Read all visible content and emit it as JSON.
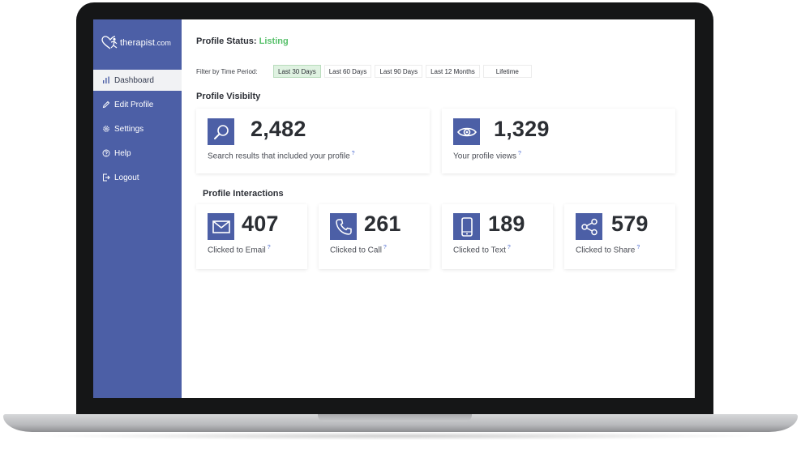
{
  "brand": {
    "name": "therapist",
    "tld": ".com"
  },
  "sidebar": {
    "items": [
      {
        "label": "Dashboard",
        "icon": "bar-chart-icon",
        "active": true
      },
      {
        "label": "Edit Profile",
        "icon": "pencil-icon",
        "active": false
      },
      {
        "label": "Settings",
        "icon": "gear-icon",
        "active": false
      },
      {
        "label": "Help",
        "icon": "question-icon",
        "active": false
      },
      {
        "label": "Logout",
        "icon": "logout-icon",
        "active": false
      }
    ]
  },
  "status": {
    "label": "Profile Status:",
    "value": "Listing",
    "value_color": "#57c06a"
  },
  "filter": {
    "label": "Filter by Time Period:",
    "options": [
      "Last 30 Days",
      "Last 60 Days",
      "Last 90 Days",
      "Last 12 Months",
      "Lifetime"
    ],
    "selected": "Last 30 Days"
  },
  "visibility": {
    "title": "Profile Visibilty",
    "cards": [
      {
        "value": "2,482",
        "caption": "Search results that included your profile",
        "icon": "search-icon"
      },
      {
        "value": "1,329",
        "caption": "Your profile views",
        "icon": "eye-icon"
      }
    ]
  },
  "interactions": {
    "title": "Profile Interactions",
    "cards": [
      {
        "value": "407",
        "caption": "Clicked to Email",
        "icon": "envelope-icon"
      },
      {
        "value": "261",
        "caption": "Clicked to Call",
        "icon": "phone-icon"
      },
      {
        "value": "189",
        "caption": "Clicked to Text",
        "icon": "mobile-icon"
      },
      {
        "value": "579",
        "caption": "Clicked to Share",
        "icon": "share-icon"
      }
    ]
  },
  "help_glyph": "?",
  "colors": {
    "sidebar": "#4c5fa6",
    "accent_green": "#57c06a",
    "icon_bg": "#4c5fa6"
  }
}
